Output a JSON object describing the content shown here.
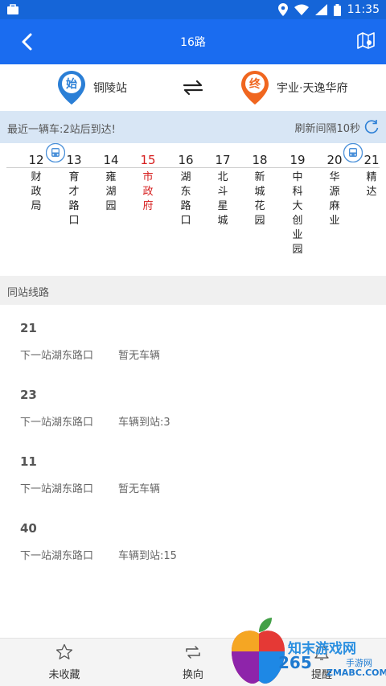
{
  "status_bar": {
    "time": "11:35"
  },
  "header": {
    "title": "16路"
  },
  "endpoints": {
    "start": {
      "badge": "始",
      "name": "铜陵站",
      "color": "#2b7fd6"
    },
    "end": {
      "badge": "终",
      "name": "宇业·天逸华府",
      "color": "#f0661f"
    }
  },
  "notice": {
    "text": "最近一辆车:2站后到达!",
    "refresh": "刷新间隔10秒"
  },
  "stations": [
    {
      "num": "12",
      "name": "财政局"
    },
    {
      "num": "13",
      "name": "育才路口"
    },
    {
      "num": "14",
      "name": "雍湖园"
    },
    {
      "num": "15",
      "name": "市政府",
      "active": true
    },
    {
      "num": "16",
      "name": "湖东路口"
    },
    {
      "num": "17",
      "name": "北斗星城"
    },
    {
      "num": "18",
      "name": "新城花园"
    },
    {
      "num": "19",
      "name": "中科大创业园"
    },
    {
      "num": "20",
      "name": "华源麻业"
    },
    {
      "num": "21",
      "name": "精达"
    }
  ],
  "same_station": {
    "title": "同站线路",
    "routes": [
      {
        "num": "21",
        "next": "下一站湖东路口",
        "status": "暂无车辆"
      },
      {
        "num": "23",
        "next": "下一站湖东路口",
        "status": "车辆到站:3"
      },
      {
        "num": "11",
        "next": "下一站湖东路口",
        "status": "暂无车辆"
      },
      {
        "num": "40",
        "next": "下一站湖东路口",
        "status": "车辆到站:15"
      }
    ]
  },
  "tabbar": {
    "favorite": "未收藏",
    "reverse": "换向",
    "remind": "提醒"
  },
  "watermark": {
    "line1": "知末游戏网",
    "line2": "265",
    "line3": "手游网",
    "line4": "ZMABC.COM"
  },
  "colors": {
    "primary": "#1a6cf0",
    "active_station": "#d61e1e",
    "notice_bg": "#d8e6f5"
  }
}
